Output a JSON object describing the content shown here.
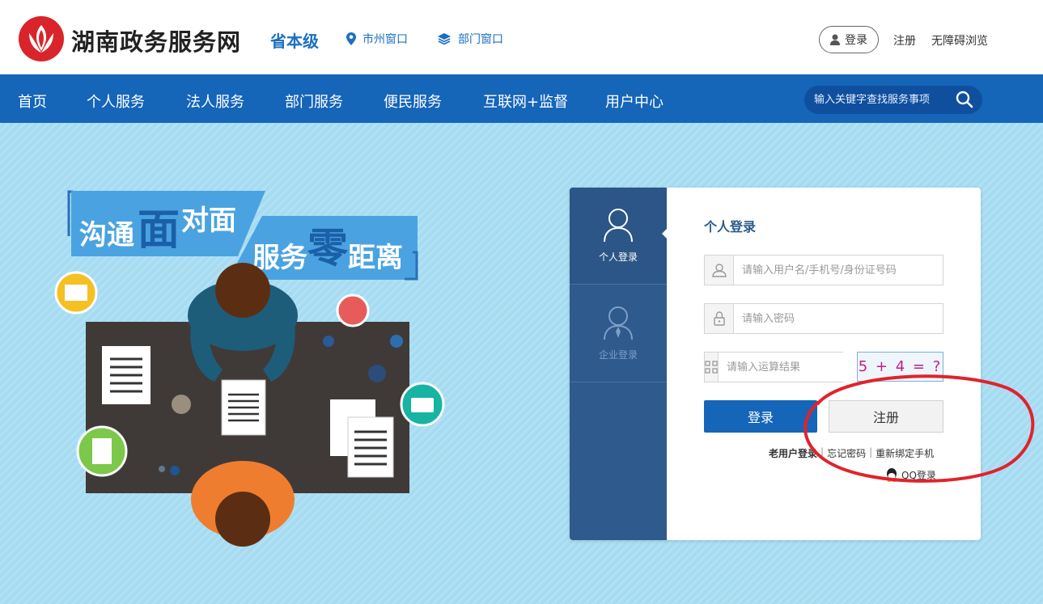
{
  "header": {
    "site_name": "湖南政务服务网",
    "level": "省本级",
    "city_link": "市州窗口",
    "dept_link": "部门窗口",
    "login_label": "登录",
    "register_label": "注册",
    "accessible_label": "无障碍浏览"
  },
  "nav": {
    "items": [
      "首页",
      "个人服务",
      "法人服务",
      "部门服务",
      "便民服务",
      "互联网+监督",
      "用户中心"
    ],
    "search_placeholder": "输入关键字查找服务事项"
  },
  "banner": {
    "line1_a": "沟通",
    "line1_b": "面",
    "line1_c": "对面",
    "line2_a": "服务",
    "line2_b": "零",
    "line2_c": "距离"
  },
  "login": {
    "tab_personal": "个人登录",
    "tab_enterprise": "企业登录",
    "title": "个人登录",
    "username_placeholder": "请输入用户名/手机号/身份证号码",
    "password_placeholder": "请输入密码",
    "captcha_placeholder": "请输入运算结果",
    "captcha_text": "5 + 4 = ?",
    "login_button": "登录",
    "register_button": "注册",
    "old_user": "老用户登录",
    "forgot": "忘记密码",
    "rebind": "重新绑定手机",
    "qq_login": "QQ登录"
  },
  "colors": {
    "nav_bg": "#1565b9",
    "card_side": "#2e5a8e",
    "page_bg": "#a6dcf2",
    "annotation_red": "#e0232b"
  }
}
